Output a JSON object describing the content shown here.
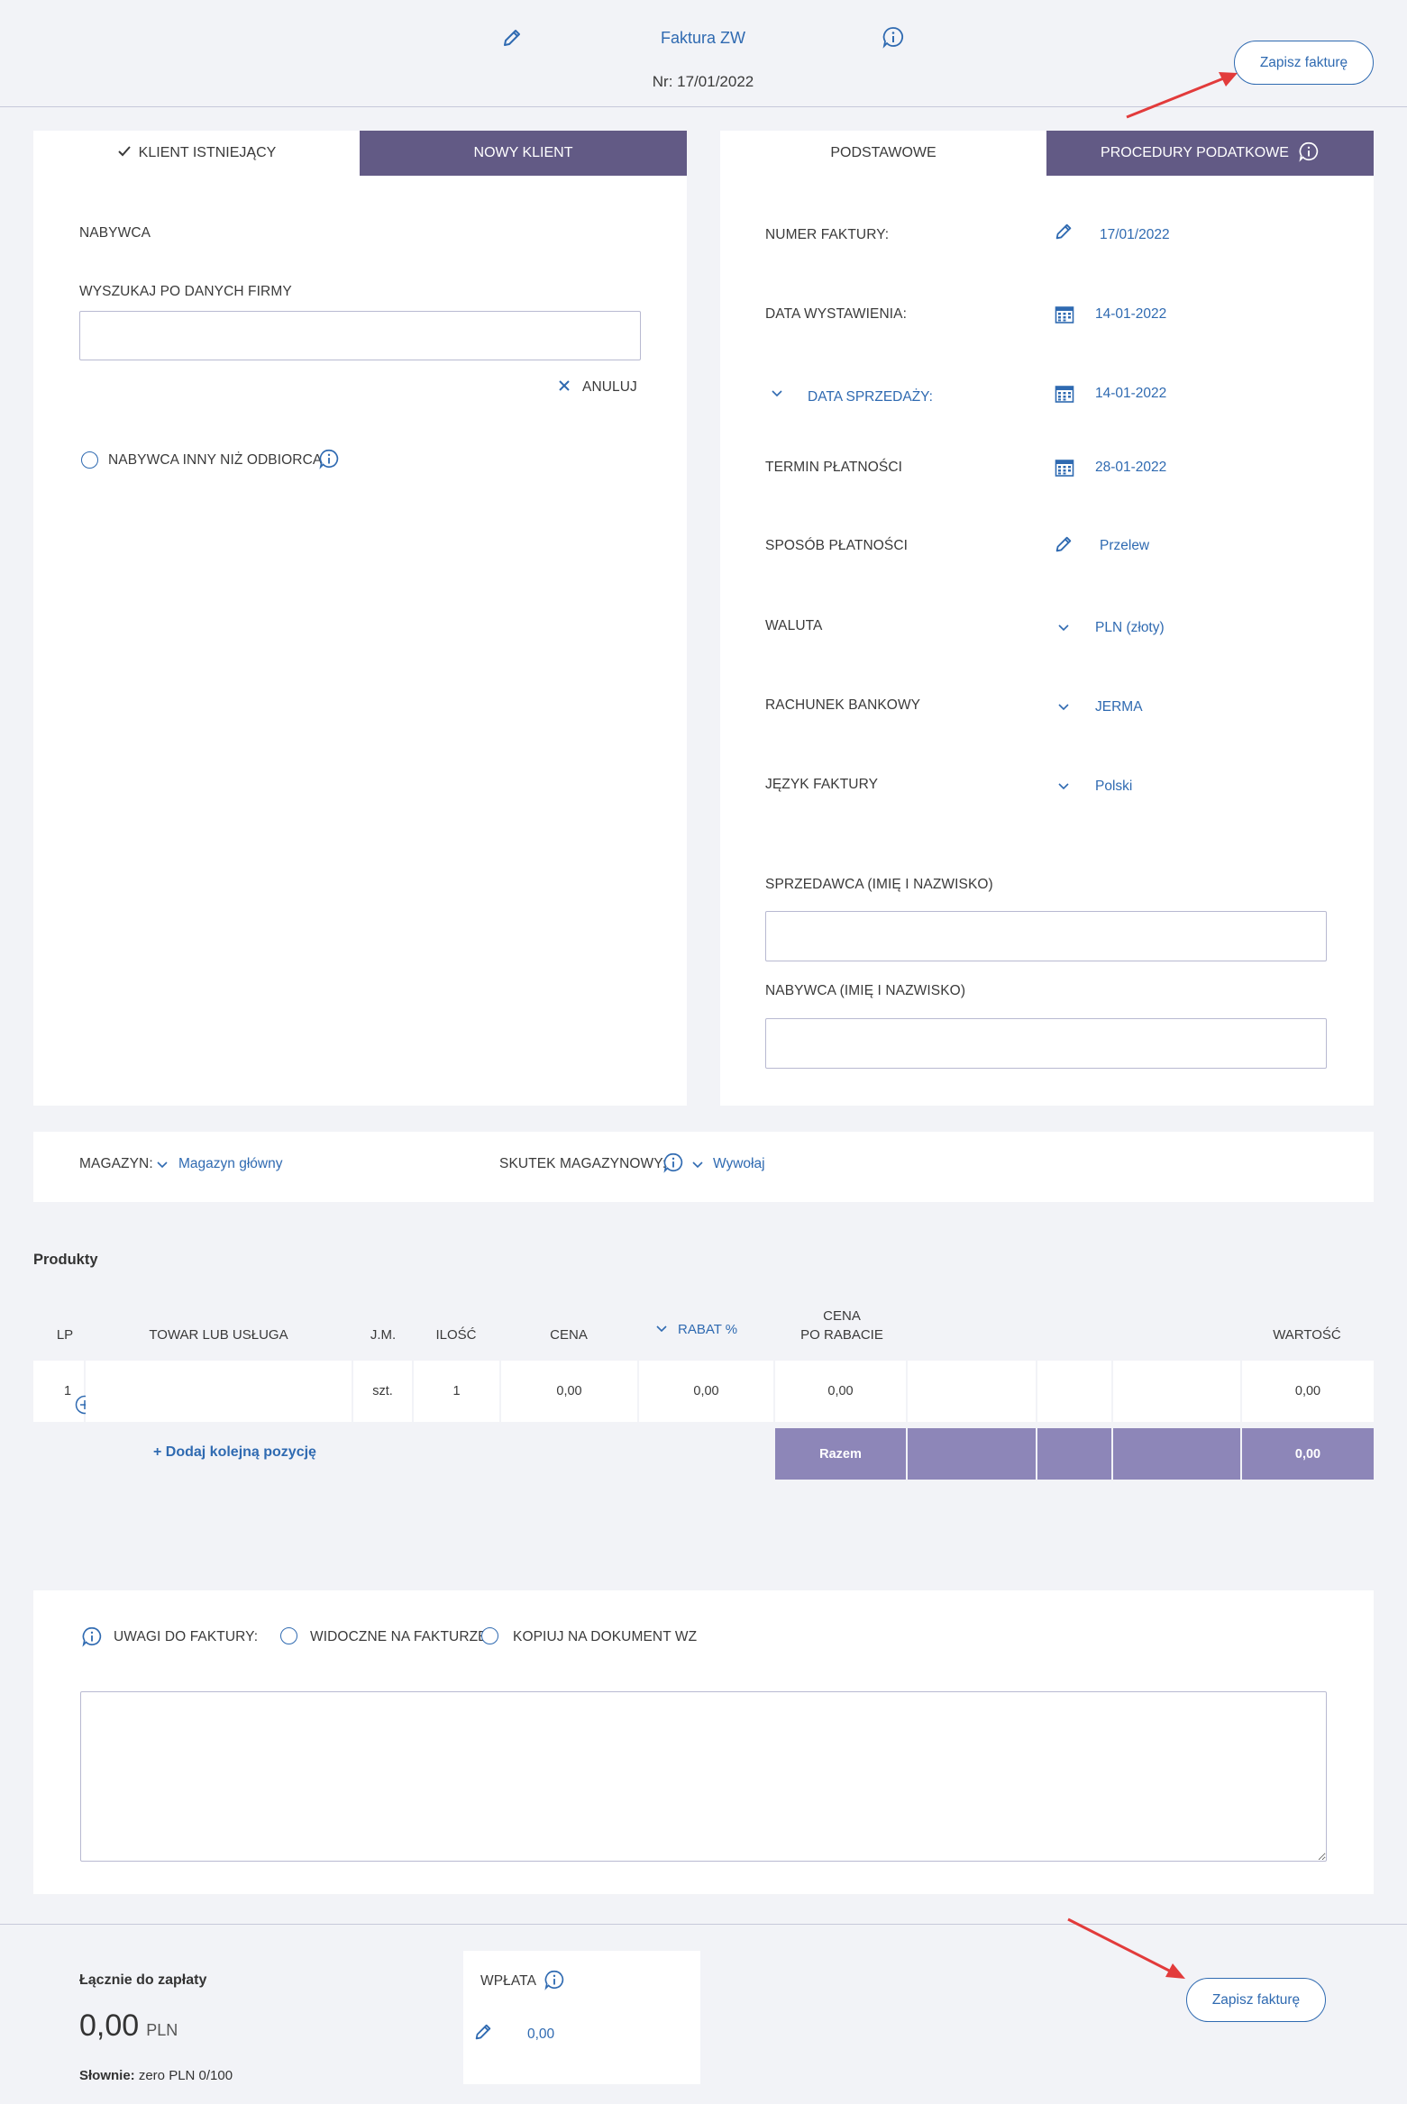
{
  "header": {
    "title": "Faktura ZW",
    "number": "Nr: 17/01/2022",
    "save_label": "Zapisz fakturę"
  },
  "client": {
    "tab_existing": "KLIENT ISTNIEJĄCY",
    "tab_new": "NOWY KLIENT",
    "buyer_heading": "NABYWCA",
    "search_label": "WYSZUKAJ PO DANYCH FIRMY",
    "search_value": "",
    "cancel_label": "ANULUJ",
    "other_recipient_label": "NABYWCA INNY NIŻ ODBIORCA"
  },
  "details": {
    "tab_basic": "PODSTAWOWE",
    "tab_tax": "PROCEDURY PODATKOWE",
    "rows": [
      {
        "label": "NUMER FAKTURY:",
        "value": "17/01/2022",
        "icon": "pencil-icon"
      },
      {
        "label": "DATA WYSTAWIENIA:",
        "value": "14-01-2022",
        "icon": "calendar-icon"
      },
      {
        "label": "DATA SPRZEDAŻY:",
        "value": "14-01-2022",
        "icon": "calendar-icon"
      },
      {
        "label": "TERMIN PŁATNOŚCI",
        "value": "28-01-2022",
        "icon": "calendar-icon"
      },
      {
        "label": "SPOSÓB PŁATNOŚCI",
        "value": "Przelew",
        "icon": "pencil-icon"
      },
      {
        "label": "WALUTA",
        "value": "PLN (złoty)",
        "icon": "chevron-down-icon"
      },
      {
        "label": "RACHUNEK BANKOWY",
        "value": "JERMA",
        "icon": "chevron-down-icon"
      },
      {
        "label": "JĘZYK FAKTURY",
        "value": "Polski",
        "icon": "chevron-down-icon"
      }
    ],
    "seller_name_label": "SPRZEDAWCA (IMIĘ I NAZWISKO)",
    "buyer_name_label": "NABYWCA (IMIĘ I NAZWISKO)"
  },
  "warehouse": {
    "label": "MAGAZYN:",
    "value": "Magazyn główny",
    "effect_label": "SKUTEK MAGAZYNOWY:",
    "effect_value": "Wywołaj"
  },
  "products": {
    "heading": "Produkty",
    "columns": {
      "lp": "LP",
      "item": "TOWAR LUB USŁUGA",
      "unit": "J.M.",
      "qty": "ILOŚĆ",
      "price": "CENA",
      "discount": "RABAT %",
      "price_after_1": "CENA",
      "price_after_2": "PO RABACIE",
      "value": "WARTOŚĆ"
    },
    "rows": [
      {
        "lp": "1",
        "item": "",
        "unit": "szt.",
        "qty": "1",
        "price": "0,00",
        "discount": "0,00",
        "price_after": "0,00",
        "value": "0,00"
      }
    ],
    "add_row_label": "+ Dodaj kolejną pozycję",
    "total_label": "Razem",
    "total_value": "0,00"
  },
  "notes": {
    "label": "UWAGI DO FAKTURY:",
    "visible_label": "WIDOCZNE NA FAKTURZE",
    "copy_label": "KOPIUJ NA DOKUMENT WZ",
    "text": ""
  },
  "footer": {
    "total_label": "Łącznie do zapłaty",
    "total_amount": "0,00",
    "currency": "PLN",
    "words_label": "Słownie:",
    "words_value": "zero PLN 0/100",
    "payment_label": "WPŁATA",
    "payment_value": "0,00"
  },
  "colors": {
    "accent": "#2f6ab1",
    "tab_dark": "#625a85",
    "total_row": "#8d86b8",
    "arrow": "#e23b3b"
  }
}
